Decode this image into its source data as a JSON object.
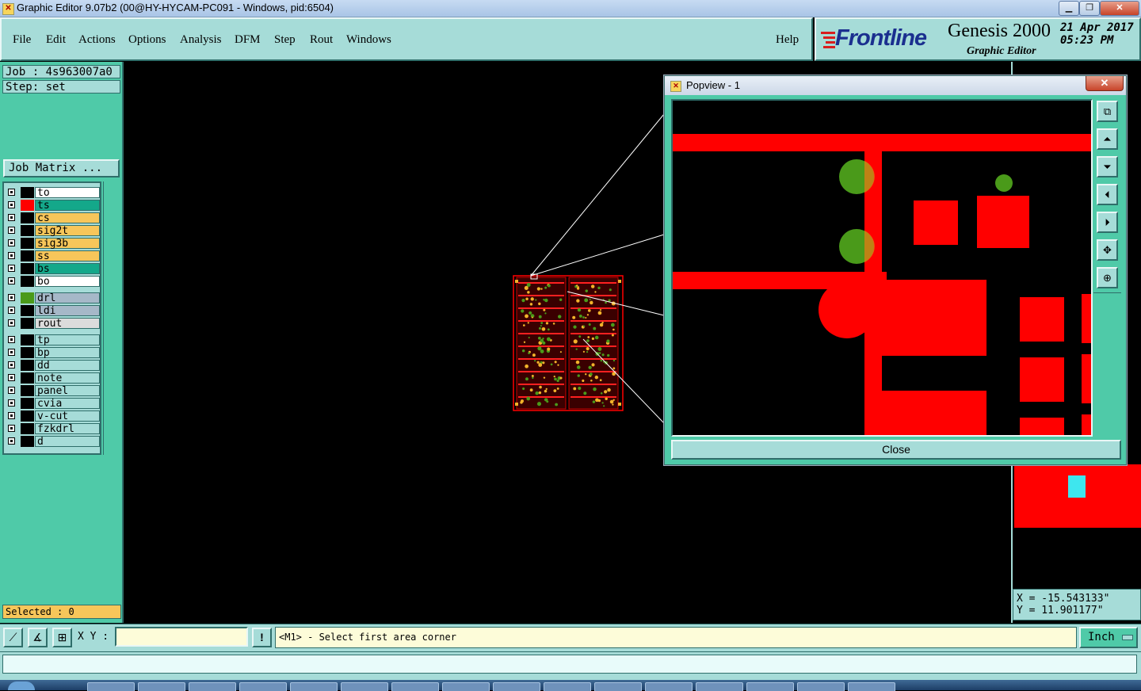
{
  "window": {
    "title": "Graphic Editor 9.07b2 (00@HY-HYCAM-PC091 - Windows, pid:6504)"
  },
  "menu": {
    "items": [
      "File",
      "Edit",
      "Actions",
      "Options",
      "Analysis",
      "DFM",
      "Step",
      "Rout",
      "Windows"
    ],
    "help": "Help"
  },
  "brand": {
    "logo": "Frontline",
    "product": "Genesis 2000",
    "subtitle": "Graphic Editor",
    "date": "21 Apr 2017",
    "time": "05:23 PM"
  },
  "job": {
    "job_label": "Job : 4s963007a0",
    "step_label": "Step: set",
    "matrix_button": "Job Matrix ..."
  },
  "layers": [
    {
      "name": "to",
      "bg": "#ffffff",
      "swatch": "#000000"
    },
    {
      "name": "ts",
      "bg": "#14a88a",
      "swatch": "#ff0000"
    },
    {
      "name": "cs",
      "bg": "#f7c65a",
      "swatch": "#000000"
    },
    {
      "name": "sig2t",
      "bg": "#f7c65a",
      "swatch": "#000000"
    },
    {
      "name": "sig3b",
      "bg": "#f7c65a",
      "swatch": "#000000"
    },
    {
      "name": "ss",
      "bg": "#f7c65a",
      "swatch": "#000000"
    },
    {
      "name": "bs",
      "bg": "#14a88a",
      "swatch": "#000000"
    },
    {
      "name": "bo",
      "bg": "#ffffff",
      "swatch": "#000000"
    },
    {
      "name": "drl",
      "bg": "#a6b8c8",
      "swatch": "#4a9a1a"
    },
    {
      "name": "ldi",
      "bg": "#a6b8c8",
      "swatch": "#000000"
    },
    {
      "name": "rout",
      "bg": "#dcdcdc",
      "swatch": "#000000"
    },
    {
      "name": "tp",
      "bg": "#a6dcd8",
      "swatch": "#000000"
    },
    {
      "name": "bp",
      "bg": "#a6dcd8",
      "swatch": "#000000"
    },
    {
      "name": "dd",
      "bg": "#a6dcd8",
      "swatch": "#000000"
    },
    {
      "name": "note",
      "bg": "#a6dcd8",
      "swatch": "#000000"
    },
    {
      "name": "panel",
      "bg": "#a6dcd8",
      "swatch": "#000000"
    },
    {
      "name": "cvia",
      "bg": "#a6dcd8",
      "swatch": "#000000"
    },
    {
      "name": "v-cut",
      "bg": "#a6dcd8",
      "swatch": "#000000"
    },
    {
      "name": "fzkdrl",
      "bg": "#a6dcd8",
      "swatch": "#000000"
    },
    {
      "name": "d",
      "bg": "#a6dcd8",
      "swatch": "#000000"
    }
  ],
  "selected_label": "Selected : 0",
  "command": {
    "xy_label": "X Y :",
    "xy_value": "",
    "message": "<M1> - Select first area corner",
    "units": "Inch"
  },
  "coords": {
    "x": "X = -15.543133\"",
    "y": "Y = 11.901177\""
  },
  "popview": {
    "title": "Popview - 1",
    "close_label": "Close"
  },
  "colors": {
    "panel": "#a6dcd8",
    "panel_dark": "#4fcaa8",
    "copper": "#ff0000",
    "drill": "#4a9a1a"
  }
}
